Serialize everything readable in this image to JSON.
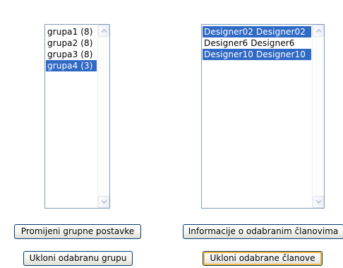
{
  "groups_list": {
    "items": [
      {
        "label": "grupa1 (8)",
        "selected": false
      },
      {
        "label": "grupa2 (8)",
        "selected": false
      },
      {
        "label": "grupa3 (8)",
        "selected": false
      },
      {
        "label": "grupa4 (3)",
        "selected": true
      }
    ]
  },
  "members_list": {
    "items": [
      {
        "label": "Designer02 Designer02",
        "selected": true
      },
      {
        "label": "Designer6 Designer6",
        "selected": false
      },
      {
        "label": "Designer10 Designer10",
        "selected": true
      }
    ]
  },
  "buttons": {
    "change_group_settings": "Promijeni grupne postavke",
    "member_info": "Informacije o odabranim članovima",
    "remove_group": "Ukloni odabranu grupu",
    "remove_members": "Ukloni odabrane članove"
  },
  "colors": {
    "selection_bg": "#316ac5",
    "selection_fg": "#ffffff",
    "listbox_border": "#7f9db9",
    "button_border": "#003c74",
    "focus_ring": "#f8b636"
  },
  "icons": {
    "scroll_up": "chevron-up-icon",
    "scroll_down": "chevron-down-icon"
  }
}
